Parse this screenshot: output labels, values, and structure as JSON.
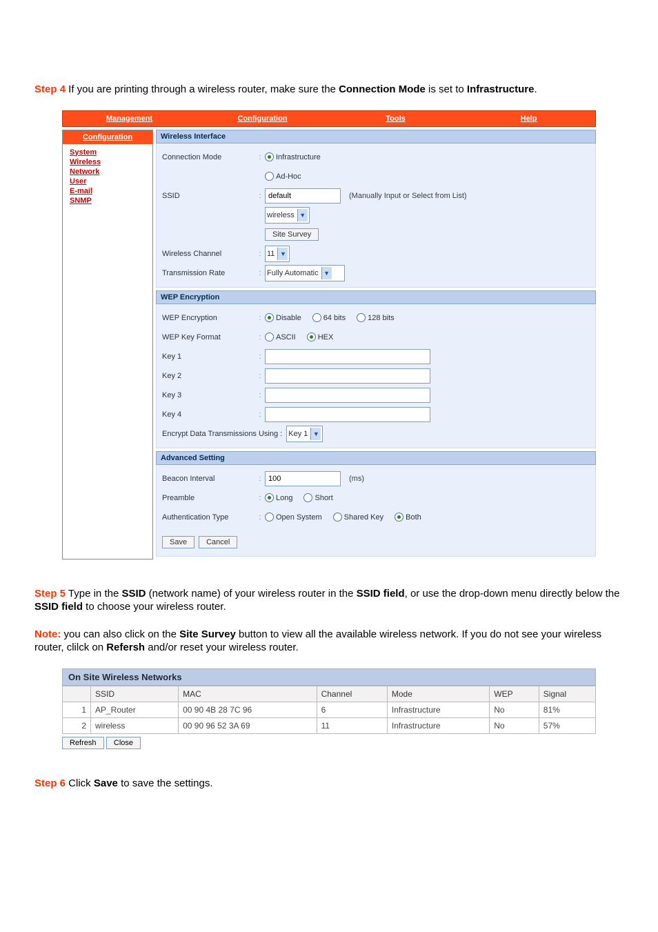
{
  "steps": {
    "step4": {
      "label": "Step 4",
      "text_before": " If you are printing through a wireless router, make sure the ",
      "bold1": "Connection Mode",
      "text_mid": " is set to ",
      "bold2": "Infrastructure",
      "text_after": "."
    },
    "step5": {
      "label": "Step 5",
      "t1": " Type in the ",
      "b1": "SSID",
      "t2": " (network name) of your wireless router in the ",
      "b2": "SSID field",
      "t3": ", or use the drop-down menu directly below the ",
      "b3": "SSID field",
      "t4": " to choose your wireless router."
    },
    "note": {
      "label": "Note:",
      "t1": " you can also click on the ",
      "b1": "Site Survey",
      "t2": " button to view all the available wireless network. If you do not see your wireless router, clilck on ",
      "b2": "Refersh",
      "t3": " and/or reset your wireless router."
    },
    "step6": {
      "label": "Step 6",
      "t1": " Click ",
      "b1": "Save",
      "t2": " to save the settings."
    }
  },
  "tabs": [
    "Management",
    "Configuration",
    "Tools",
    "Help"
  ],
  "sidebar": {
    "title": "Configuration",
    "links": [
      "System",
      "Wireless",
      "Network",
      "User",
      "E-mail",
      "SNMP"
    ]
  },
  "wireless_interface": {
    "header": "Wireless Interface",
    "connection_mode": {
      "label": "Connection Mode",
      "opts": [
        "Infrastructure",
        "Ad-Hoc"
      ],
      "selected": 0
    },
    "ssid": {
      "label": "SSID",
      "value": "default",
      "hint": "(Manually Input or Select from List)"
    },
    "ssid_select": "wireless",
    "site_survey_btn": "Site Survey",
    "channel": {
      "label": "Wireless Channel",
      "value": "11"
    },
    "rate": {
      "label": "Transmission Rate",
      "value": "Fully Automatic"
    }
  },
  "wep": {
    "header": "WEP Encryption",
    "encryption": {
      "label": "WEP Encryption",
      "opts": [
        "Disable",
        "64 bits",
        "128 bits"
      ],
      "selected": 0
    },
    "keyformat": {
      "label": "WEP Key Format",
      "opts": [
        "ASCII",
        "HEX"
      ],
      "selected": 1
    },
    "keys": {
      "k1": "Key 1",
      "k2": "Key 2",
      "k3": "Key 3",
      "k4": "Key 4"
    },
    "encrypt_using": {
      "label": "Encrypt Data Transmissions Using :",
      "value": "Key 1"
    }
  },
  "advanced": {
    "header": "Advanced Setting",
    "beacon": {
      "label": "Beacon Interval",
      "value": "100",
      "unit": "(ms)"
    },
    "preamble": {
      "label": "Preamble",
      "opts": [
        "Long",
        "Short"
      ],
      "selected": 0
    },
    "auth": {
      "label": "Authentication Type",
      "opts": [
        "Open System",
        "Shared Key",
        "Both"
      ],
      "selected": 2
    },
    "save": "Save",
    "cancel": "Cancel"
  },
  "survey": {
    "title": "On Site Wireless Networks",
    "cols": {
      "n": "",
      "ssid": "SSID",
      "mac": "MAC",
      "channel": "Channel",
      "mode": "Mode",
      "wep": "WEP",
      "signal": "Signal"
    },
    "rows": [
      {
        "n": "1",
        "ssid": "AP_Router",
        "mac": "00 90 4B 28 7C 96",
        "channel": "6",
        "mode": "Infrastructure",
        "wep": "No",
        "signal": "81%"
      },
      {
        "n": "2",
        "ssid": "wireless",
        "mac": "00 90 96 52 3A 69",
        "channel": "11",
        "mode": "Infrastructure",
        "wep": "No",
        "signal": "57%"
      }
    ],
    "refresh": "Refresh",
    "close": "Close"
  }
}
